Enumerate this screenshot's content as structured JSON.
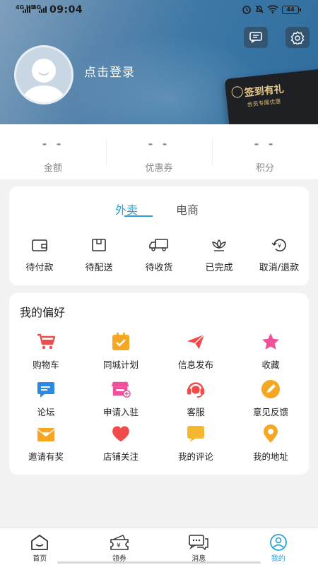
{
  "status_bar": {
    "sig1": "4G HD",
    "sig2": "4G",
    "time": "09:04",
    "battery": "44"
  },
  "header": {
    "login_text": "点击登录",
    "vip_card": {
      "title": "签到有礼",
      "subtitle": "会员专属优惠"
    }
  },
  "stats": [
    {
      "value": "- -",
      "label": "金额"
    },
    {
      "value": "- -",
      "label": "优惠券"
    },
    {
      "value": "- -",
      "label": "积分"
    }
  ],
  "orders": {
    "tabs": [
      "外卖",
      "电商"
    ],
    "active_tab": "外卖",
    "items": [
      {
        "label": "待付款",
        "icon": "wallet-icon"
      },
      {
        "label": "待配送",
        "icon": "package-icon"
      },
      {
        "label": "待收货",
        "icon": "truck-icon"
      },
      {
        "label": "已完成",
        "icon": "lotus-icon"
      },
      {
        "label": "取消/退款",
        "icon": "refund-icon"
      }
    ]
  },
  "preferences": {
    "title": "我的偏好",
    "items": [
      {
        "label": "购物车",
        "icon": "cart-icon",
        "color": "#f04a4a"
      },
      {
        "label": "同城计划",
        "icon": "calendar-check-icon",
        "color": "#f5a623"
      },
      {
        "label": "信息发布",
        "icon": "paper-plane-icon",
        "color": "#f04a4a"
      },
      {
        "label": "收藏",
        "icon": "star-icon",
        "color": "#f0509a"
      },
      {
        "label": "论坛",
        "icon": "chat-icon",
        "color": "#2a8ae6"
      },
      {
        "label": "申请入驻",
        "icon": "store-icon",
        "color": "#f0509a"
      },
      {
        "label": "客服",
        "icon": "headset-icon",
        "color": "#f04a4a"
      },
      {
        "label": "意见反馈",
        "icon": "pencil-icon",
        "color": "#f5a623"
      },
      {
        "label": "邀请有奖",
        "icon": "envelope-heart-icon",
        "color": "#f5a623"
      },
      {
        "label": "店铺关注",
        "icon": "heart-icon",
        "color": "#f04a4a"
      },
      {
        "label": "我的评论",
        "icon": "comment-icon",
        "color": "#f5b730"
      },
      {
        "label": "我的地址",
        "icon": "location-icon",
        "color": "#f5a623"
      }
    ]
  },
  "bottom_nav": [
    {
      "label": "首页",
      "icon": "home-icon"
    },
    {
      "label": "领券",
      "icon": "coupon-icon"
    },
    {
      "label": "消息",
      "icon": "message-icon"
    },
    {
      "label": "我的",
      "icon": "profile-icon",
      "active": true
    }
  ],
  "colors": {
    "accent": "#2a9fd6",
    "header_start": "#7fa0bd",
    "header_end": "#2e6d9e",
    "vip_gold": "#e9c98a"
  }
}
